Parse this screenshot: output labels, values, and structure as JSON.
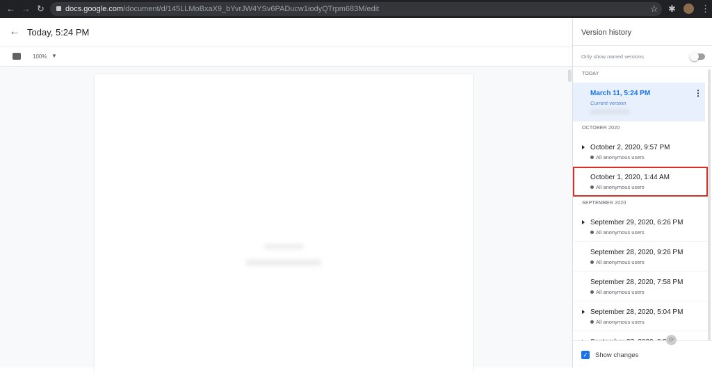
{
  "browser": {
    "url_host": "docs.google.com",
    "url_path": "/document/d/145LLMoBxaX9_bYvrJW4YSv6PADucw1iodyQTrpm683M/edit"
  },
  "header": {
    "title": "Today, 5:24 PM"
  },
  "toolbar": {
    "zoom": "100%"
  },
  "sidebar": {
    "title": "Version history",
    "named_toggle_label": "Only show named versions",
    "named_toggle_on": false,
    "sections": [
      {
        "label": "TODAY",
        "items": [
          {
            "date": "March 11, 5:24 PM",
            "sub": "Current version",
            "selected": true
          }
        ]
      },
      {
        "label": "OCTOBER 2020",
        "items": [
          {
            "date": "October 2, 2020, 9:57 PM",
            "user": "All anonymous users",
            "expandable": true
          },
          {
            "date": "October 1, 2020, 1:44 AM",
            "user": "All anonymous users",
            "highlighted": true
          }
        ]
      },
      {
        "label": "SEPTEMBER 2020",
        "items": [
          {
            "date": "September 29, 2020, 6:26 PM",
            "user": "All anonymous users",
            "expandable": true
          },
          {
            "date": "September 28, 2020, 9:26 PM",
            "user": "All anonymous users"
          },
          {
            "date": "September 28, 2020, 7:58 PM",
            "user": "All anonymous users"
          },
          {
            "date": "September 28, 2020, 5:04 PM",
            "user": "All anonymous users",
            "expandable": true
          },
          {
            "date": "September 27, 2020, 9:5",
            "user": "",
            "expandable": true
          }
        ]
      }
    ],
    "show_changes_label": "Show changes",
    "show_changes_checked": true
  },
  "colors": {
    "accent": "#1a73e8",
    "highlight_border": "#d93025",
    "selected_bg": "#e8f0fe"
  }
}
